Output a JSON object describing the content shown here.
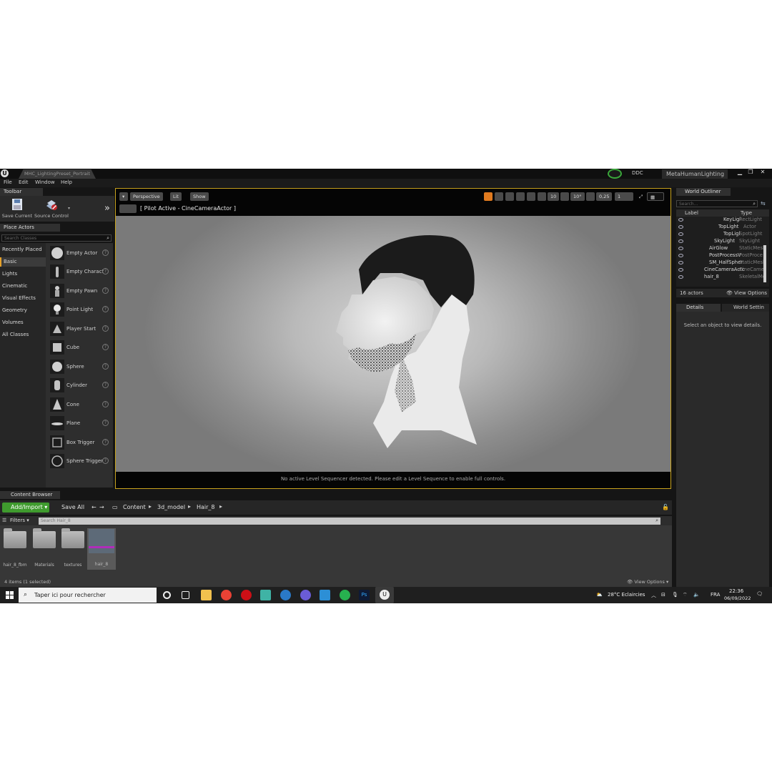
{
  "window": {
    "doc_tab": "MHC_LightingPreset_Portrait",
    "ddc_label": "DDC",
    "project_name": "MetaHumanLighting"
  },
  "menu": [
    "File",
    "Edit",
    "Window",
    "Help"
  ],
  "toolbar": {
    "tab_label": "Toolbar",
    "save_current": "Save Current",
    "source_control": "Source Control"
  },
  "place_actors": {
    "tab_label": "Place Actors",
    "search_placeholder": "Search Classes",
    "categories": [
      "Recently Placed",
      "Basic",
      "Lights",
      "Cinematic",
      "Visual Effects",
      "Geometry",
      "Volumes",
      "All Classes"
    ],
    "selected_category": "Basic",
    "items": [
      "Empty Actor",
      "Empty Charact",
      "Empty Pawn",
      "Point Light",
      "Player Start",
      "Cube",
      "Sphere",
      "Cylinder",
      "Cone",
      "Plane",
      "Box Trigger",
      "Sphere Trigger"
    ]
  },
  "viewport": {
    "perspective_label": "Perspective",
    "lit_label": "Lit",
    "show_label": "Show",
    "grid_snap": "10",
    "rot_snap": "10°",
    "scale_snap": "0,25",
    "cam_speed": "1",
    "pilot_text": "[ Pilot Active - CineCameraActor ]",
    "sequencer_msg": "No active Level Sequencer detected. Please edit a Level Sequence to enable full controls."
  },
  "world_outliner": {
    "tab_label": "World Outliner",
    "search_placeholder": "Search...",
    "col_label": "Label",
    "col_type": "Type",
    "rows": [
      {
        "name": "KeyLigl",
        "type": "RectLight"
      },
      {
        "name": "TopLight",
        "type": "Actor"
      },
      {
        "name": "TopLigl",
        "type": "SpotLight"
      },
      {
        "name": "SkyLight",
        "type": "SkyLight"
      },
      {
        "name": "AirGlow",
        "type": "StaticMesl"
      },
      {
        "name": "PostProcessV",
        "type": "PostProce"
      },
      {
        "name": "SM_HalfSpher",
        "type": "StaticMesl"
      },
      {
        "name": "CineCameraActc",
        "type": "CineCame"
      },
      {
        "name": "hair_8",
        "type": "SkeletalMe"
      }
    ],
    "actor_count": "16 actors",
    "view_options": "View Options"
  },
  "details": {
    "tab_label": "Details",
    "world_settings_tab": "World Settin",
    "empty_msg": "Select an object to view details."
  },
  "content_browser": {
    "tab_label": "Content Browser",
    "add_import": "Add/Import",
    "save_all": "Save All",
    "path": [
      "Content",
      "3d_model",
      "Hair_8"
    ],
    "filters": "Filters",
    "search_placeholder": "Search Hair_8",
    "assets": [
      "hair_8_fbm",
      "Materials",
      "textures",
      "hair_8"
    ],
    "status": "4 items (1 selected)",
    "view_options": "View Options"
  },
  "taskbar": {
    "search_placeholder": "Taper ici pour rechercher",
    "weather": "28°C  Eclaircies",
    "language": "FRA",
    "time": "22:36",
    "date": "06/09/2022"
  },
  "colors": {
    "accent": "#e6a12a",
    "viewport_border": "#c8a21d",
    "add_button": "#3f9b2e"
  }
}
